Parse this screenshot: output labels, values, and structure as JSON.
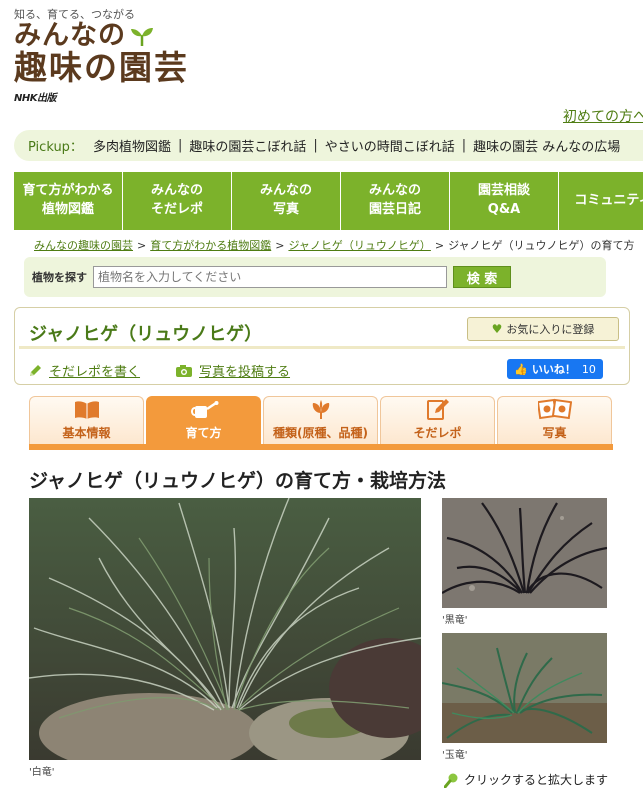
{
  "header": {
    "tagline": "知る、育てる、つながる",
    "logo_line1": "みんなの",
    "logo_line2": "趣味の園芸",
    "publisher": "NHK出版",
    "first_time_link": "初めての方へ"
  },
  "pickup": {
    "label": "Pickup：",
    "items": [
      "多肉植物図鑑",
      "趣味の園芸こぼれ話",
      "やさいの時間こぼれ話",
      "趣味の園芸 みんなの広場"
    ]
  },
  "nav": {
    "items": [
      "育て方がわかる\n植物図鑑",
      "みんなの\nそだレポ",
      "みんなの\n写真",
      "みんなの\n園芸日記",
      "園芸相談\nQ&A",
      "コミュニティ"
    ]
  },
  "breadcrumb": {
    "items": [
      "みんなの趣味の園芸",
      "育て方がわかる植物図鑑",
      "ジャノヒゲ（リュウノヒゲ）"
    ],
    "current": "ジャノヒゲ（リュウノヒゲ）の育て方"
  },
  "search": {
    "label": "植物を探す",
    "placeholder": "植物名を入力してください",
    "button": "検 索"
  },
  "plant": {
    "title": "ジャノヒゲ（リュウノヒゲ）",
    "favorite_button": "お気に入りに登録",
    "write_report": "そだレポを書く",
    "post_photo": "写真を投稿する",
    "like_label": "いいね！",
    "like_count": "10"
  },
  "tabs": {
    "items": [
      "基本情報",
      "育て方",
      "種類(原種、品種)",
      "そだレポ",
      "写真"
    ],
    "active_index": 1
  },
  "content": {
    "heading": "ジャノヒゲ（リュウノヒゲ）の育て方・栽培方法",
    "main_caption": "'白竜'",
    "thumb1_caption": "'黒竜'",
    "thumb2_caption": "'玉竜'",
    "zoom_hint": "クリックすると拡大します"
  },
  "colors": {
    "brand_green": "#7cb22b",
    "link_green": "#4f7d13",
    "tab_orange": "#f39a3c",
    "logo_brown": "#5b3a1e"
  }
}
